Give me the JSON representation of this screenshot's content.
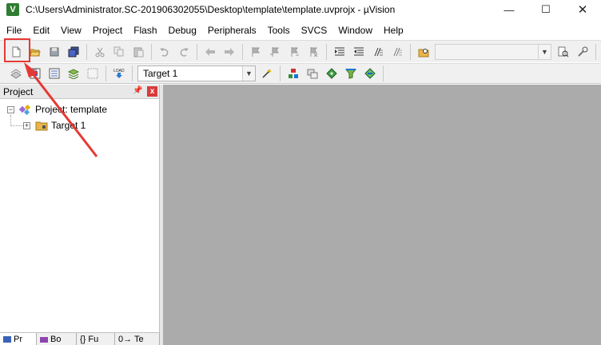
{
  "window": {
    "title": "C:\\Users\\Administrator.SC-201906302055\\Desktop\\template\\template.uvprojx - µVision",
    "app_icon": "uvision-logo-icon",
    "controls": {
      "minimize": "—",
      "maximize": "☐",
      "close": "✕"
    }
  },
  "menu": [
    {
      "label": "File"
    },
    {
      "label": "Edit"
    },
    {
      "label": "View"
    },
    {
      "label": "Project"
    },
    {
      "label": "Flash"
    },
    {
      "label": "Debug"
    },
    {
      "label": "Peripherals"
    },
    {
      "label": "Tools"
    },
    {
      "label": "SVCS"
    },
    {
      "label": "Window"
    },
    {
      "label": "Help"
    }
  ],
  "toolbar2": {
    "target_select": {
      "value": "Target 1"
    }
  },
  "project_panel": {
    "title": "Project",
    "pin": "ᴾ",
    "close": "x",
    "tree": {
      "root_label": "Project: template",
      "child_label": "Target 1"
    },
    "tabs": [
      {
        "label": "Pr",
        "icon": "project-icon"
      },
      {
        "label": "Bo",
        "icon": "books-icon"
      },
      {
        "label": "{} Fu",
        "icon": "functions-icon"
      },
      {
        "label": "0→ Te",
        "icon": "templates-icon"
      }
    ]
  },
  "colors": {
    "highlight": "#e53935",
    "editor_background": "#ababab"
  }
}
